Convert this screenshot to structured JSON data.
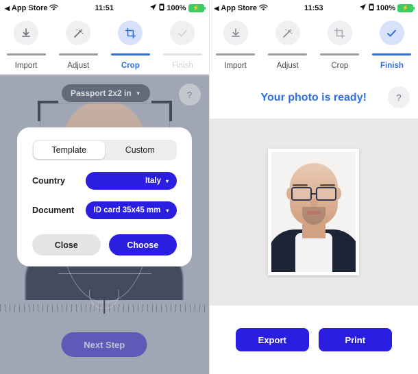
{
  "left_screen": {
    "status_bar": {
      "back_app": "App Store",
      "back_icon": "back-triangle-icon",
      "wifi_icon": "wifi-icon",
      "time": "11:51",
      "location_icon": "location-arrow-icon",
      "alarm_icon": "alarm-clock-icon",
      "battery_percent": "100%",
      "battery_icon": "battery-charging-icon"
    },
    "steps": [
      {
        "label": "Import",
        "icon": "download-arrow-icon",
        "state": "done"
      },
      {
        "label": "Adjust",
        "icon": "magic-wand-icon",
        "state": "done"
      },
      {
        "label": "Crop",
        "icon": "crop-icon",
        "state": "active"
      },
      {
        "label": "Finish",
        "icon": "check-icon",
        "state": "future"
      }
    ],
    "format_selector": {
      "label": "Passport 2x2 in",
      "caret": "▼"
    },
    "help_label": "?",
    "next_step_label": "Next Step"
  },
  "modal": {
    "tabs": [
      {
        "label": "Template",
        "selected": true
      },
      {
        "label": "Custom",
        "selected": false
      }
    ],
    "fields": [
      {
        "label": "Country",
        "value": "Italy",
        "caret": "▾"
      },
      {
        "label": "Document",
        "value": "ID card 35x45 mm",
        "caret": "▾"
      }
    ],
    "close_label": "Close",
    "choose_label": "Choose"
  },
  "right_screen": {
    "status_bar": {
      "back_app": "App Store",
      "back_icon": "back-triangle-icon",
      "wifi_icon": "wifi-icon",
      "time": "11:53",
      "location_icon": "location-arrow-icon",
      "alarm_icon": "alarm-clock-icon",
      "battery_percent": "100%",
      "battery_icon": "battery-charging-icon"
    },
    "steps": [
      {
        "label": "Import",
        "icon": "download-arrow-icon",
        "state": "done"
      },
      {
        "label": "Adjust",
        "icon": "magic-wand-icon",
        "state": "done"
      },
      {
        "label": "Crop",
        "icon": "crop-icon",
        "state": "done"
      },
      {
        "label": "Finish",
        "icon": "check-icon",
        "state": "active"
      }
    ],
    "title": "Your photo is ready!",
    "help_label": "?",
    "export_label": "Export",
    "print_label": "Print"
  },
  "colors": {
    "accent_blue": "#2f6fe0",
    "primary_indigo": "#2a1ee0",
    "editor_bg": "#aeb3c0",
    "result_bg": "#e9e9e9",
    "battery_green": "#3ecb5f"
  }
}
